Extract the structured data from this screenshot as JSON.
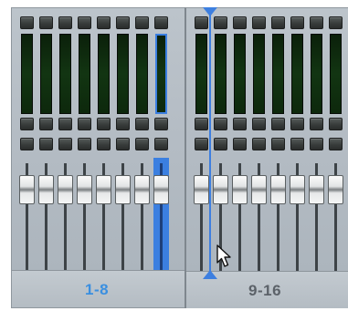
{
  "banks": [
    {
      "label": "1-8",
      "label_color": "#3a8fe0",
      "selected_channel": 8,
      "channel_count": 8
    },
    {
      "label": "9-16",
      "label_color": "#5c6269",
      "channel_count": 8
    }
  ],
  "colors": {
    "selection": "#3b7fe0",
    "meter": "#123512",
    "panel": "#b3bbc3"
  },
  "icons": [
    "playhead-marker-icon",
    "mouse-pointer-icon"
  ]
}
